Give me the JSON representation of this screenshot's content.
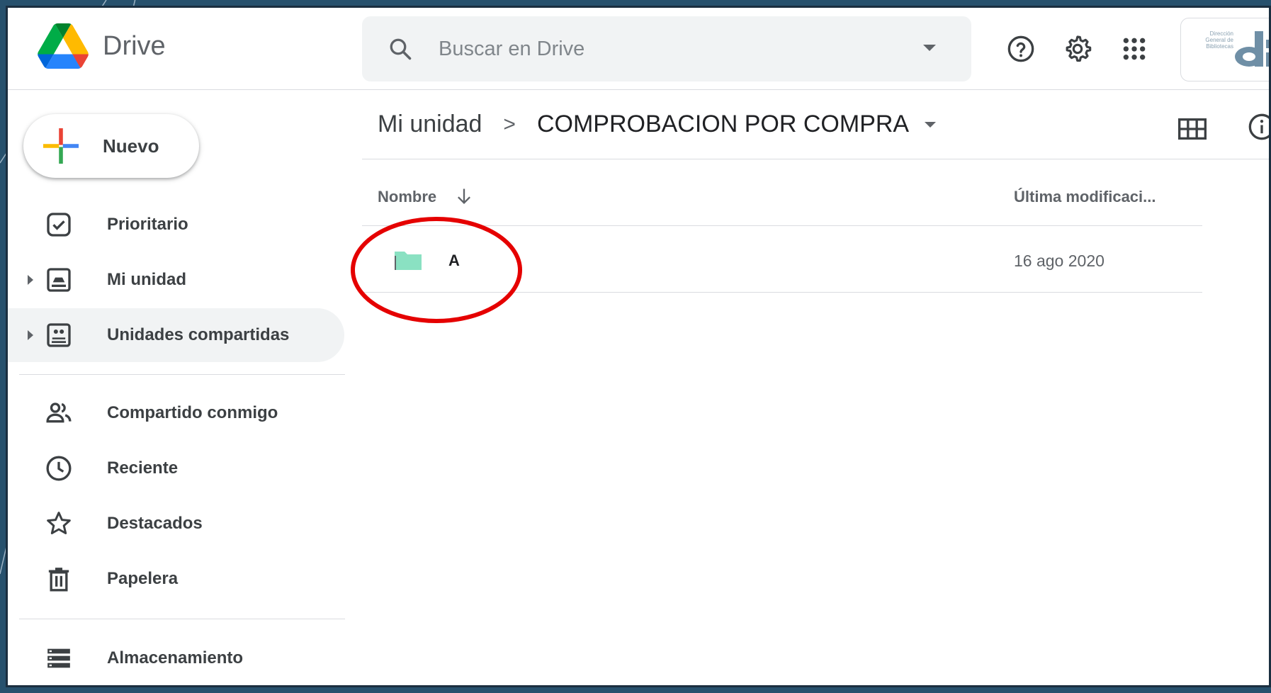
{
  "app": {
    "name": "Drive"
  },
  "search": {
    "placeholder": "Buscar en Drive"
  },
  "header_icons": [
    "help-icon",
    "settings-icon",
    "apps-grid-icon"
  ],
  "account": {
    "logo_text": [
      "Dirección",
      "General de",
      "Bibliotecas"
    ]
  },
  "sidebar": {
    "new_label": "Nuevo",
    "items": [
      {
        "label": "Prioritario",
        "icon": "priority-icon"
      },
      {
        "label": "Mi unidad",
        "icon": "my-drive-icon"
      },
      {
        "label": "Unidades compartidas",
        "icon": "shared-drives-icon"
      },
      {
        "label": "Compartido conmigo",
        "icon": "shared-with-me-icon"
      },
      {
        "label": "Reciente",
        "icon": "clock-icon"
      },
      {
        "label": "Destacados",
        "icon": "star-icon"
      },
      {
        "label": "Papelera",
        "icon": "trash-icon"
      },
      {
        "label": "Almacenamiento",
        "icon": "storage-icon"
      }
    ]
  },
  "breadcrumb": {
    "root": "Mi unidad",
    "separator": ">",
    "current": "COMPROBACION POR COMPRA"
  },
  "list": {
    "columns": {
      "name": "Nombre",
      "modified": "Última modificaci..."
    },
    "rows": [
      {
        "name": "A",
        "modified": "16 ago 2020",
        "type": "folder",
        "color": "#8ae1c2"
      }
    ]
  },
  "colors": {
    "annotation": "#e50000",
    "slide_bg": "#27516d"
  }
}
